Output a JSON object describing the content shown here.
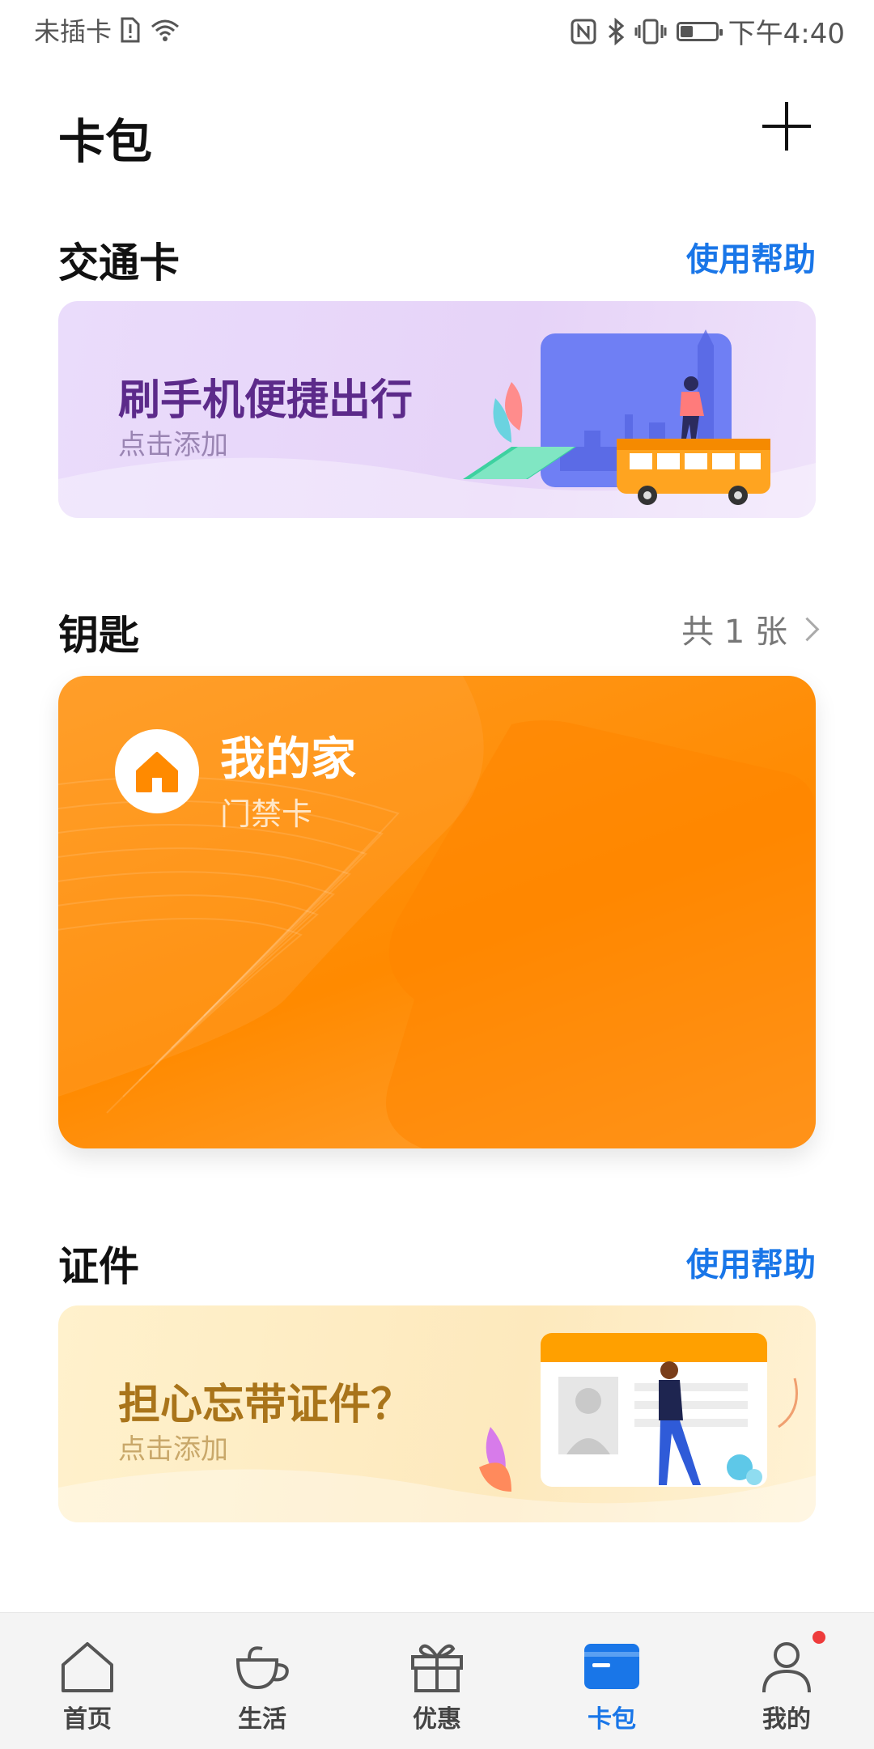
{
  "status_bar": {
    "carrier": "未插卡",
    "time": "下午4:40",
    "battery_level": 0.35
  },
  "header": {
    "title": "卡包"
  },
  "transport": {
    "title": "交通卡",
    "help": "使用帮助",
    "promo_title": "刷手机便捷出行",
    "promo_sub": "点击添加"
  },
  "keys": {
    "title": "钥匙",
    "count": "共 1 张",
    "card_name": "我的家",
    "card_type": "门禁卡"
  },
  "ids": {
    "title": "证件",
    "help": "使用帮助",
    "promo_title": "担心忘带证件？",
    "promo_sub": "点击添加"
  },
  "tabs": [
    {
      "label": "首页",
      "icon": "home-icon"
    },
    {
      "label": "生活",
      "icon": "cup-icon"
    },
    {
      "label": "优惠",
      "icon": "gift-icon"
    },
    {
      "label": "卡包",
      "icon": "card-icon"
    },
    {
      "label": "我的",
      "icon": "user-icon"
    }
  ],
  "colors": {
    "accent": "#1976e8",
    "key_card": "#ff8a00",
    "transport_bg": "#e8d8fa",
    "id_bg": "#fdebc0"
  }
}
